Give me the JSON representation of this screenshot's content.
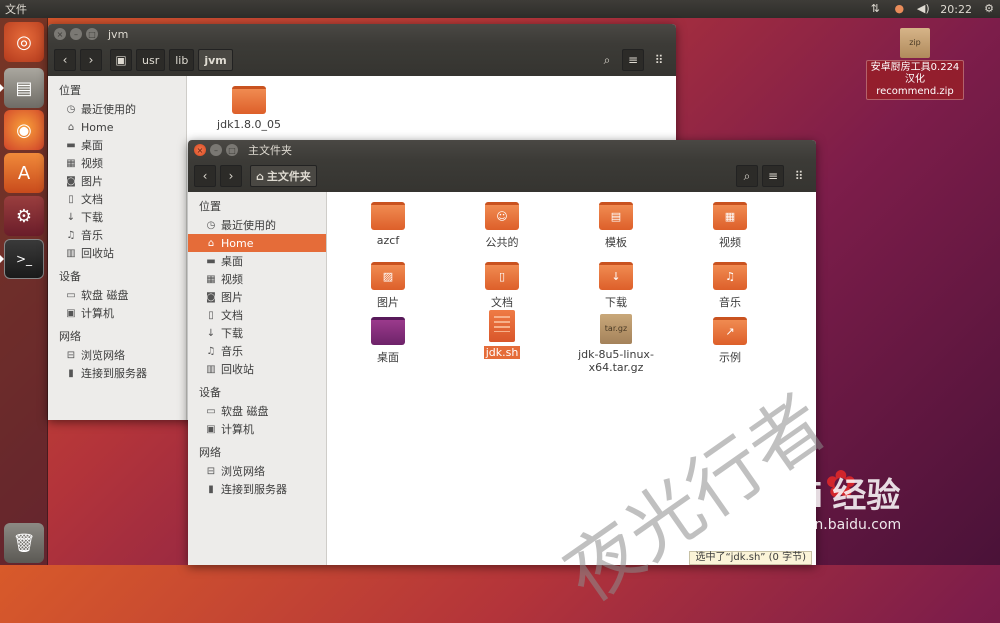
{
  "top_panel": {
    "app_menu": "文件",
    "time": "20:22",
    "indicator_icons": [
      "network-icon",
      "keyboard-icon",
      "volume-icon",
      "gear-icon"
    ]
  },
  "launcher": {
    "items": [
      "ubuntu-dash",
      "files",
      "firefox",
      "software-center",
      "system-settings",
      "terminal",
      "trash"
    ]
  },
  "desktop": {
    "icon_badge": "zip",
    "icon_label": "安卓厨房工具0.224汉化 recommend.zip"
  },
  "back_window": {
    "title": "jvm",
    "breadcrumbs": [
      "usr",
      "lib",
      "jvm"
    ],
    "sidebar": {
      "places_header": "位置",
      "places": [
        {
          "icon": "clock-icon",
          "label": "最近使用的"
        },
        {
          "icon": "home-icon",
          "label": "Home"
        },
        {
          "icon": "folder-icon",
          "label": "桌面"
        },
        {
          "icon": "video-icon",
          "label": "视频"
        },
        {
          "icon": "camera-icon",
          "label": "图片"
        },
        {
          "icon": "document-icon",
          "label": "文档"
        },
        {
          "icon": "download-icon",
          "label": "下载"
        },
        {
          "icon": "music-icon",
          "label": "音乐"
        },
        {
          "icon": "trash-icon",
          "label": "回收站"
        }
      ],
      "devices_header": "设备",
      "devices": [
        {
          "icon": "disk-icon",
          "label": "软盘 磁盘"
        },
        {
          "icon": "computer-icon",
          "label": "计算机"
        }
      ],
      "network_header": "网络",
      "network": [
        {
          "icon": "network-icon",
          "label": "浏览网络"
        },
        {
          "icon": "server-icon",
          "label": "连接到服务器"
        }
      ]
    },
    "files": [
      {
        "label": "jdk1.8.0_05"
      }
    ]
  },
  "front_window": {
    "title": "主文件夹",
    "breadcrumb": "主文件夹",
    "sidebar": {
      "places_header": "位置",
      "places": [
        {
          "icon": "clock-icon",
          "label": "最近使用的",
          "selected": false
        },
        {
          "icon": "home-icon",
          "label": "Home",
          "selected": true
        },
        {
          "icon": "folder-icon",
          "label": "桌面",
          "selected": false
        },
        {
          "icon": "video-icon",
          "label": "视频",
          "selected": false
        },
        {
          "icon": "camera-icon",
          "label": "图片",
          "selected": false
        },
        {
          "icon": "document-icon",
          "label": "文档",
          "selected": false
        },
        {
          "icon": "download-icon",
          "label": "下载",
          "selected": false
        },
        {
          "icon": "music-icon",
          "label": "音乐",
          "selected": false
        },
        {
          "icon": "trash-icon",
          "label": "回收站",
          "selected": false
        }
      ],
      "devices_header": "设备",
      "devices": [
        {
          "icon": "disk-icon",
          "label": "软盘 磁盘"
        },
        {
          "icon": "computer-icon",
          "label": "计算机"
        }
      ],
      "network_header": "网络",
      "network": [
        {
          "icon": "network-icon",
          "label": "浏览网络"
        },
        {
          "icon": "server-icon",
          "label": "连接到服务器"
        }
      ]
    },
    "files": [
      {
        "label": "azcf",
        "kind": "folder",
        "emblem": ""
      },
      {
        "label": "公共的",
        "kind": "folder",
        "emblem": "person-icon"
      },
      {
        "label": "模板",
        "kind": "folder",
        "emblem": "template-icon"
      },
      {
        "label": "视频",
        "kind": "folder",
        "emblem": "film-icon"
      },
      {
        "label": "图片",
        "kind": "folder",
        "emblem": "picture-icon"
      },
      {
        "label": "文档",
        "kind": "folder",
        "emblem": "document-icon"
      },
      {
        "label": "下载",
        "kind": "folder",
        "emblem": "download-icon"
      },
      {
        "label": "音乐",
        "kind": "folder",
        "emblem": "music-icon"
      },
      {
        "label": "桌面",
        "kind": "desktop",
        "emblem": ""
      },
      {
        "label": "jdk.sh",
        "kind": "script",
        "emblem": "",
        "selected": true
      },
      {
        "label": "jdk-8u5-linux-x64.tar.gz",
        "kind": "archive",
        "badge": "tar.gz"
      },
      {
        "label": "示例",
        "kind": "folder",
        "emblem": "link-icon"
      }
    ],
    "status": "选中了“jdk.sh” (0 字节)"
  },
  "watermark": {
    "text": "夜光行者",
    "brand": "Bai 经验",
    "url": "jingyan.baidu.com"
  }
}
